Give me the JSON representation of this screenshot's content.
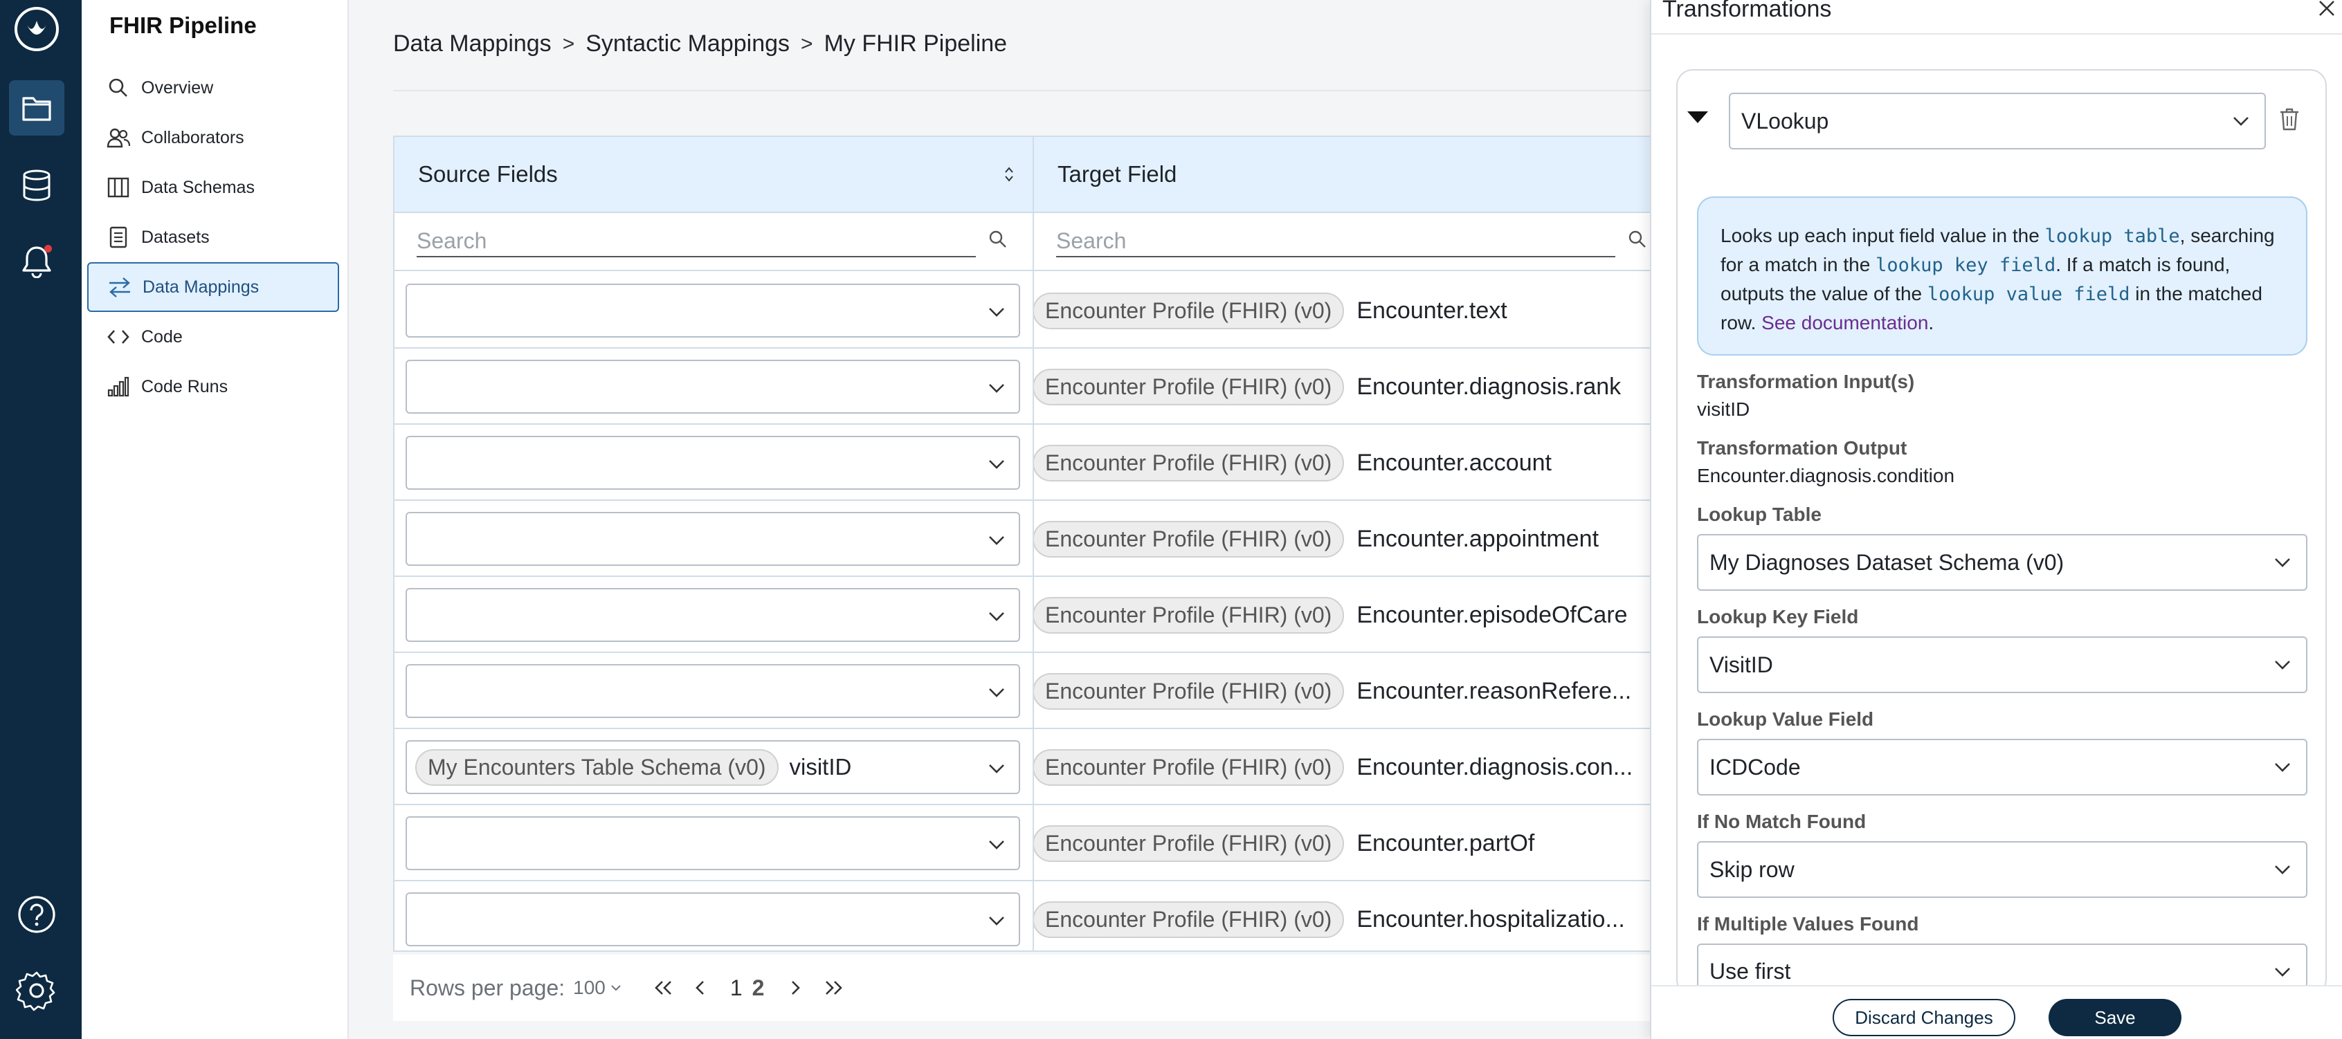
{
  "app": {
    "title": "FHIR Pipeline"
  },
  "rail": {
    "items": [
      {
        "icon": "logo-icon"
      },
      {
        "icon": "folder-icon",
        "active": true
      },
      {
        "icon": "database-icon"
      },
      {
        "icon": "bell-icon",
        "notification": true
      },
      {
        "icon": "help-icon"
      },
      {
        "icon": "settings-icon"
      }
    ]
  },
  "sidebar": {
    "items": [
      {
        "label": "Overview",
        "icon": "search-icon"
      },
      {
        "label": "Collaborators",
        "icon": "users-icon"
      },
      {
        "label": "Data Schemas",
        "icon": "columns-icon"
      },
      {
        "label": "Datasets",
        "icon": "document-icon"
      },
      {
        "label": "Data Mappings",
        "icon": "mapping-icon",
        "active": true
      },
      {
        "label": "Code",
        "icon": "code-icon"
      },
      {
        "label": "Code Runs",
        "icon": "chart-icon"
      }
    ]
  },
  "breadcrumb": {
    "items": [
      "Data Mappings",
      "Syntactic Mappings",
      "My FHIR Pipeline"
    ],
    "separator": ">"
  },
  "table": {
    "headers": {
      "source": "Source Fields",
      "target": "Target Field"
    },
    "search_placeholder": "Search",
    "rows": [
      {
        "source_chip": "",
        "source_field": "",
        "target_chip": "Encounter Profile (FHIR) (v0)",
        "target_field": "Encounter.text"
      },
      {
        "source_chip": "",
        "source_field": "",
        "target_chip": "Encounter Profile (FHIR) (v0)",
        "target_field": "Encounter.diagnosis.rank"
      },
      {
        "source_chip": "",
        "source_field": "",
        "target_chip": "Encounter Profile (FHIR) (v0)",
        "target_field": "Encounter.account"
      },
      {
        "source_chip": "",
        "source_field": "",
        "target_chip": "Encounter Profile (FHIR) (v0)",
        "target_field": "Encounter.appointment"
      },
      {
        "source_chip": "",
        "source_field": "",
        "target_chip": "Encounter Profile (FHIR) (v0)",
        "target_field": "Encounter.episodeOfCare"
      },
      {
        "source_chip": "",
        "source_field": "",
        "target_chip": "Encounter Profile (FHIR) (v0)",
        "target_field": "Encounter.reasonRefere..."
      },
      {
        "source_chip": "My Encounters Table Schema (v0)",
        "source_field": "visitID",
        "target_chip": "Encounter Profile (FHIR) (v0)",
        "target_field": "Encounter.diagnosis.con..."
      },
      {
        "source_chip": "",
        "source_field": "",
        "target_chip": "Encounter Profile (FHIR) (v0)",
        "target_field": "Encounter.partOf"
      },
      {
        "source_chip": "",
        "source_field": "",
        "target_chip": "Encounter Profile (FHIR) (v0)",
        "target_field": "Encounter.hospitalizatio..."
      }
    ]
  },
  "pager": {
    "rows_per_page_label": "Rows per page:",
    "rows_per_page_value": "100",
    "page_1": "1",
    "page_2": "2",
    "current_page": 2
  },
  "drawer": {
    "title": "Transformations",
    "transformation_type": "VLookup",
    "info": {
      "p1": "Looks up each input field value in the ",
      "code1": "lookup table",
      "p2": ", searching for a match in the ",
      "code2": "lookup key field",
      "p3": ". If a match is found, outputs the value of the ",
      "code3": "lookup value field",
      "p4": " in the matched row. ",
      "link": "See documentation",
      "p5": "."
    },
    "input_label": "Transformation Input(s)",
    "input_value": "visitID",
    "output_label": "Transformation Output",
    "output_value": "Encounter.diagnosis.condition",
    "lookup_table_label": "Lookup Table",
    "lookup_table_value": "My Diagnoses Dataset Schema (v0)",
    "lookup_key_label": "Lookup Key Field",
    "lookup_key_value": "VisitID",
    "lookup_value_label": "Lookup Value Field",
    "lookup_value_value": "ICDCode",
    "no_match_label": "If No Match Found",
    "no_match_value": "Skip row",
    "multiple_label": "If Multiple Values Found",
    "multiple_value": "Use first",
    "discard_label": "Discard Changes",
    "save_label": "Save"
  },
  "colors": {
    "rail": "#0d2a42",
    "rail_active": "#214b6e",
    "accent_light": "#e2f1fd",
    "link": "#6b2c91",
    "code": "#23628c"
  }
}
